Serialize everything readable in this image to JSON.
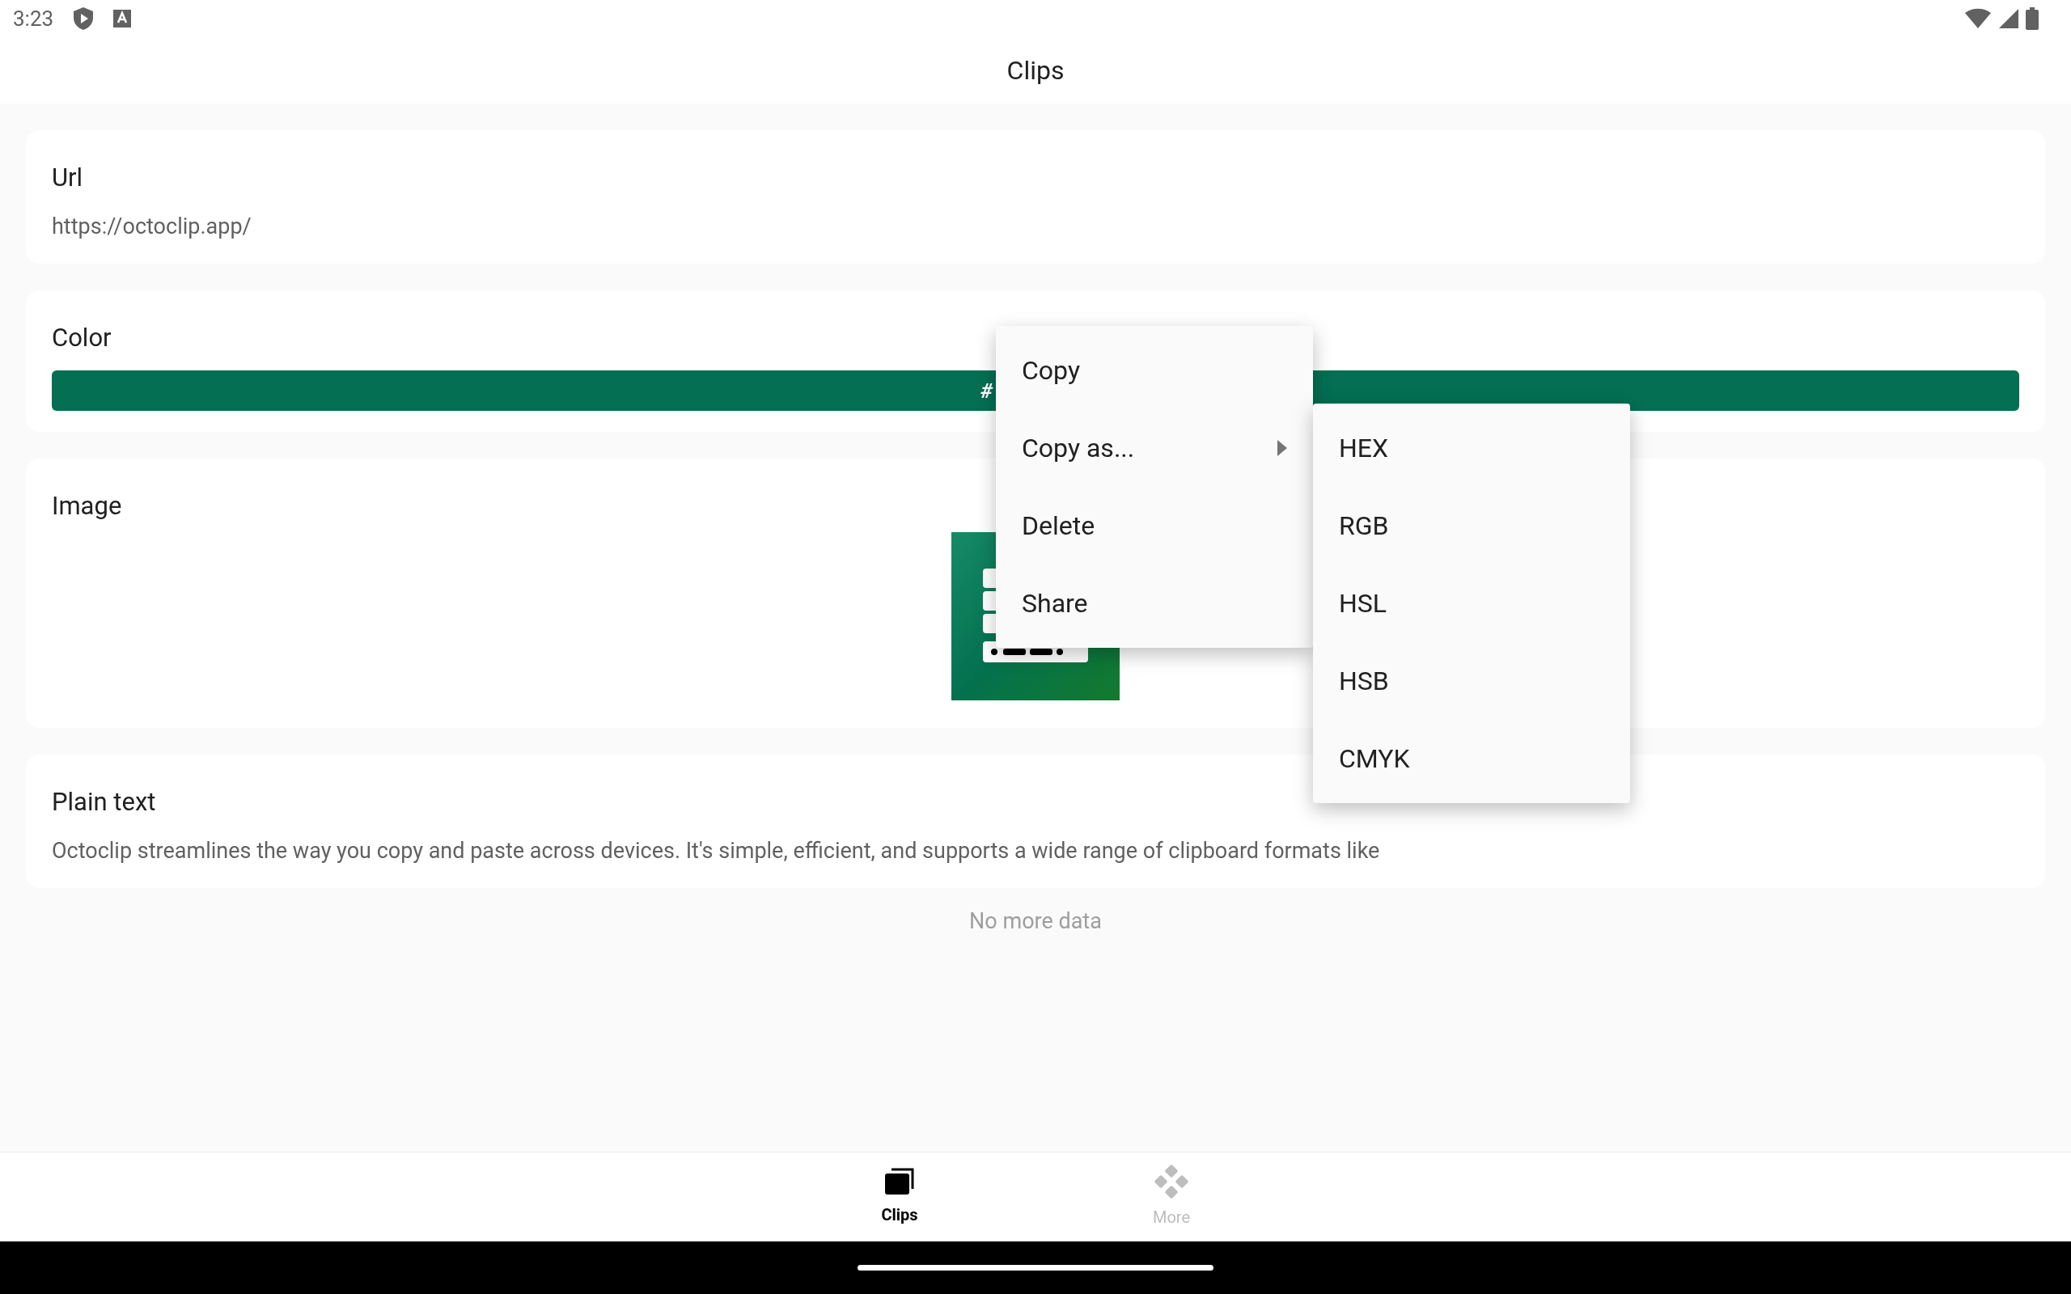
{
  "status_bar": {
    "time": "3:23"
  },
  "app_bar": {
    "title": "Clips"
  },
  "clips": [
    {
      "kind": "url",
      "label": "Url",
      "value": "https://octoclip.app/"
    },
    {
      "kind": "color",
      "label": "Color",
      "value": "#",
      "color": "#046f52"
    },
    {
      "kind": "image",
      "label": "Image"
    },
    {
      "kind": "text",
      "label": "Plain text",
      "value": "Octoclip streamlines the way you copy and paste across devices. It's simple, efficient, and supports a wide range of clipboard formats like"
    }
  ],
  "footer": "No more data",
  "context_menu": {
    "items": [
      {
        "label": "Copy",
        "has_submenu": false
      },
      {
        "label": "Copy as...",
        "has_submenu": true
      },
      {
        "label": "Delete",
        "has_submenu": false
      },
      {
        "label": "Share",
        "has_submenu": false
      }
    ]
  },
  "submenu": {
    "items": [
      "HEX",
      "RGB",
      "HSL",
      "HSB",
      "CMYK"
    ]
  },
  "bottom_nav": [
    {
      "label": "Clips",
      "selected": true,
      "kind": "clips"
    },
    {
      "label": "More",
      "selected": false,
      "kind": "more"
    }
  ]
}
